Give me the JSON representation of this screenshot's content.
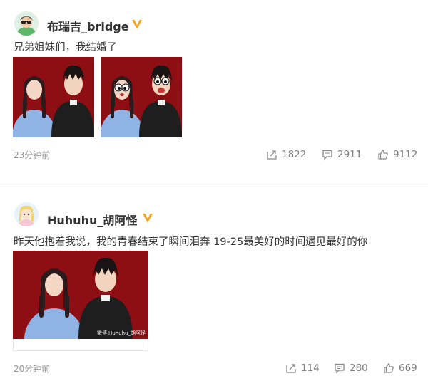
{
  "posts": [
    {
      "username": "布瑞吉_bridge",
      "content": "兄弟姐妹们，我结婚了",
      "time": "23分钟前",
      "actions": {
        "repost": "1822",
        "comment": "2911",
        "like": "9112"
      }
    },
    {
      "username": "Huhuhu_胡阿怪",
      "content": "昨天他抱着我说，我的青春结束了瞬间泪奔 19-25最美好的时间遇见最好的你",
      "photo_caption": "微博 Huhuhu_胡阿怪",
      "time": "20分钟前",
      "actions": {
        "repost": "114",
        "comment": "280",
        "like": "669"
      }
    }
  ],
  "colors": {
    "verified_badge": "#f5a623",
    "photo_background": "#8d0f14",
    "meta_text": "#999999"
  },
  "icons": [
    "repost-icon",
    "comment-icon",
    "like-icon",
    "verified-badge-icon"
  ]
}
